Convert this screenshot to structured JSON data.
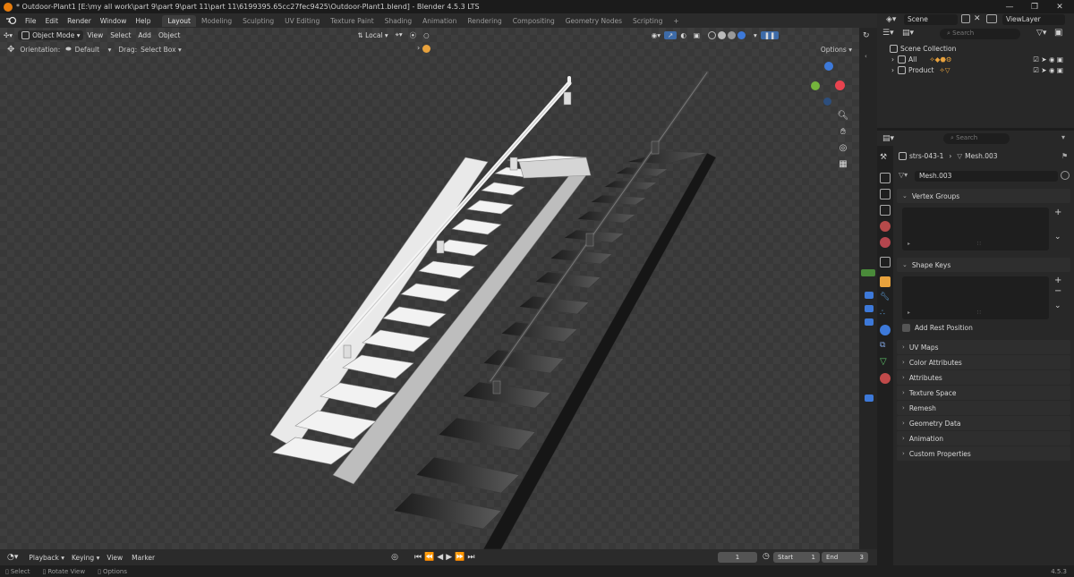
{
  "window": {
    "title": "* Outdoor-Plant1 [E:\\my all work\\part 9\\part 9\\part 11\\part 11\\6199395.65cc27fec9425\\Outdoor-Plant1.blend] - Blender 4.5.3 LTS",
    "controls": [
      "—",
      "❐",
      "✕"
    ]
  },
  "menu": {
    "items": [
      "File",
      "Edit",
      "Render",
      "Window",
      "Help"
    ],
    "workspaces": [
      "Layout",
      "Modeling",
      "Sculpting",
      "UV Editing",
      "Texture Paint",
      "Shading",
      "Animation",
      "Rendering",
      "Compositing",
      "Geometry Nodes",
      "Scripting"
    ],
    "active_workspace": "Layout",
    "add_workspace": "+",
    "scene": "Scene",
    "view_layer": "ViewLayer"
  },
  "viewport": {
    "mode": "Object Mode",
    "menus": [
      "View",
      "Select",
      "Add",
      "Object"
    ],
    "transform_orientation": "Local",
    "orientation_label": "Orientation:",
    "orientation_value": "Default",
    "drag_label": "Drag:",
    "drag_value": "Select Box",
    "options_label": "Options",
    "gizmo_colors": {
      "x": "#e8434f",
      "y": "#74b33c",
      "z": "#3d79d9"
    }
  },
  "outliner": {
    "search_placeholder": "Search",
    "root": "Scene Collection",
    "collections": [
      "All",
      "Product"
    ]
  },
  "properties": {
    "search_placeholder": "Search",
    "object_name": "strs-043-1",
    "mesh_name": "Mesh.003",
    "mesh_field": "Mesh.003",
    "panels": {
      "vertex_groups": "Vertex Groups",
      "shape_keys": "Shape Keys",
      "add_rest_position": "Add Rest Position",
      "collapsed": [
        "UV Maps",
        "Color Attributes",
        "Attributes",
        "Texture Space",
        "Remesh",
        "Geometry Data",
        "Animation",
        "Custom Properties"
      ]
    }
  },
  "timeline": {
    "menus": [
      "Playback",
      "Keying",
      "View",
      "Marker"
    ],
    "current_frame": "1",
    "start_label": "Start",
    "start_value": "1",
    "end_label": "End",
    "end_value": "3"
  },
  "statusbar": {
    "hints": [
      "Select",
      "Rotate View",
      "Options"
    ],
    "version": "4.5.3"
  }
}
